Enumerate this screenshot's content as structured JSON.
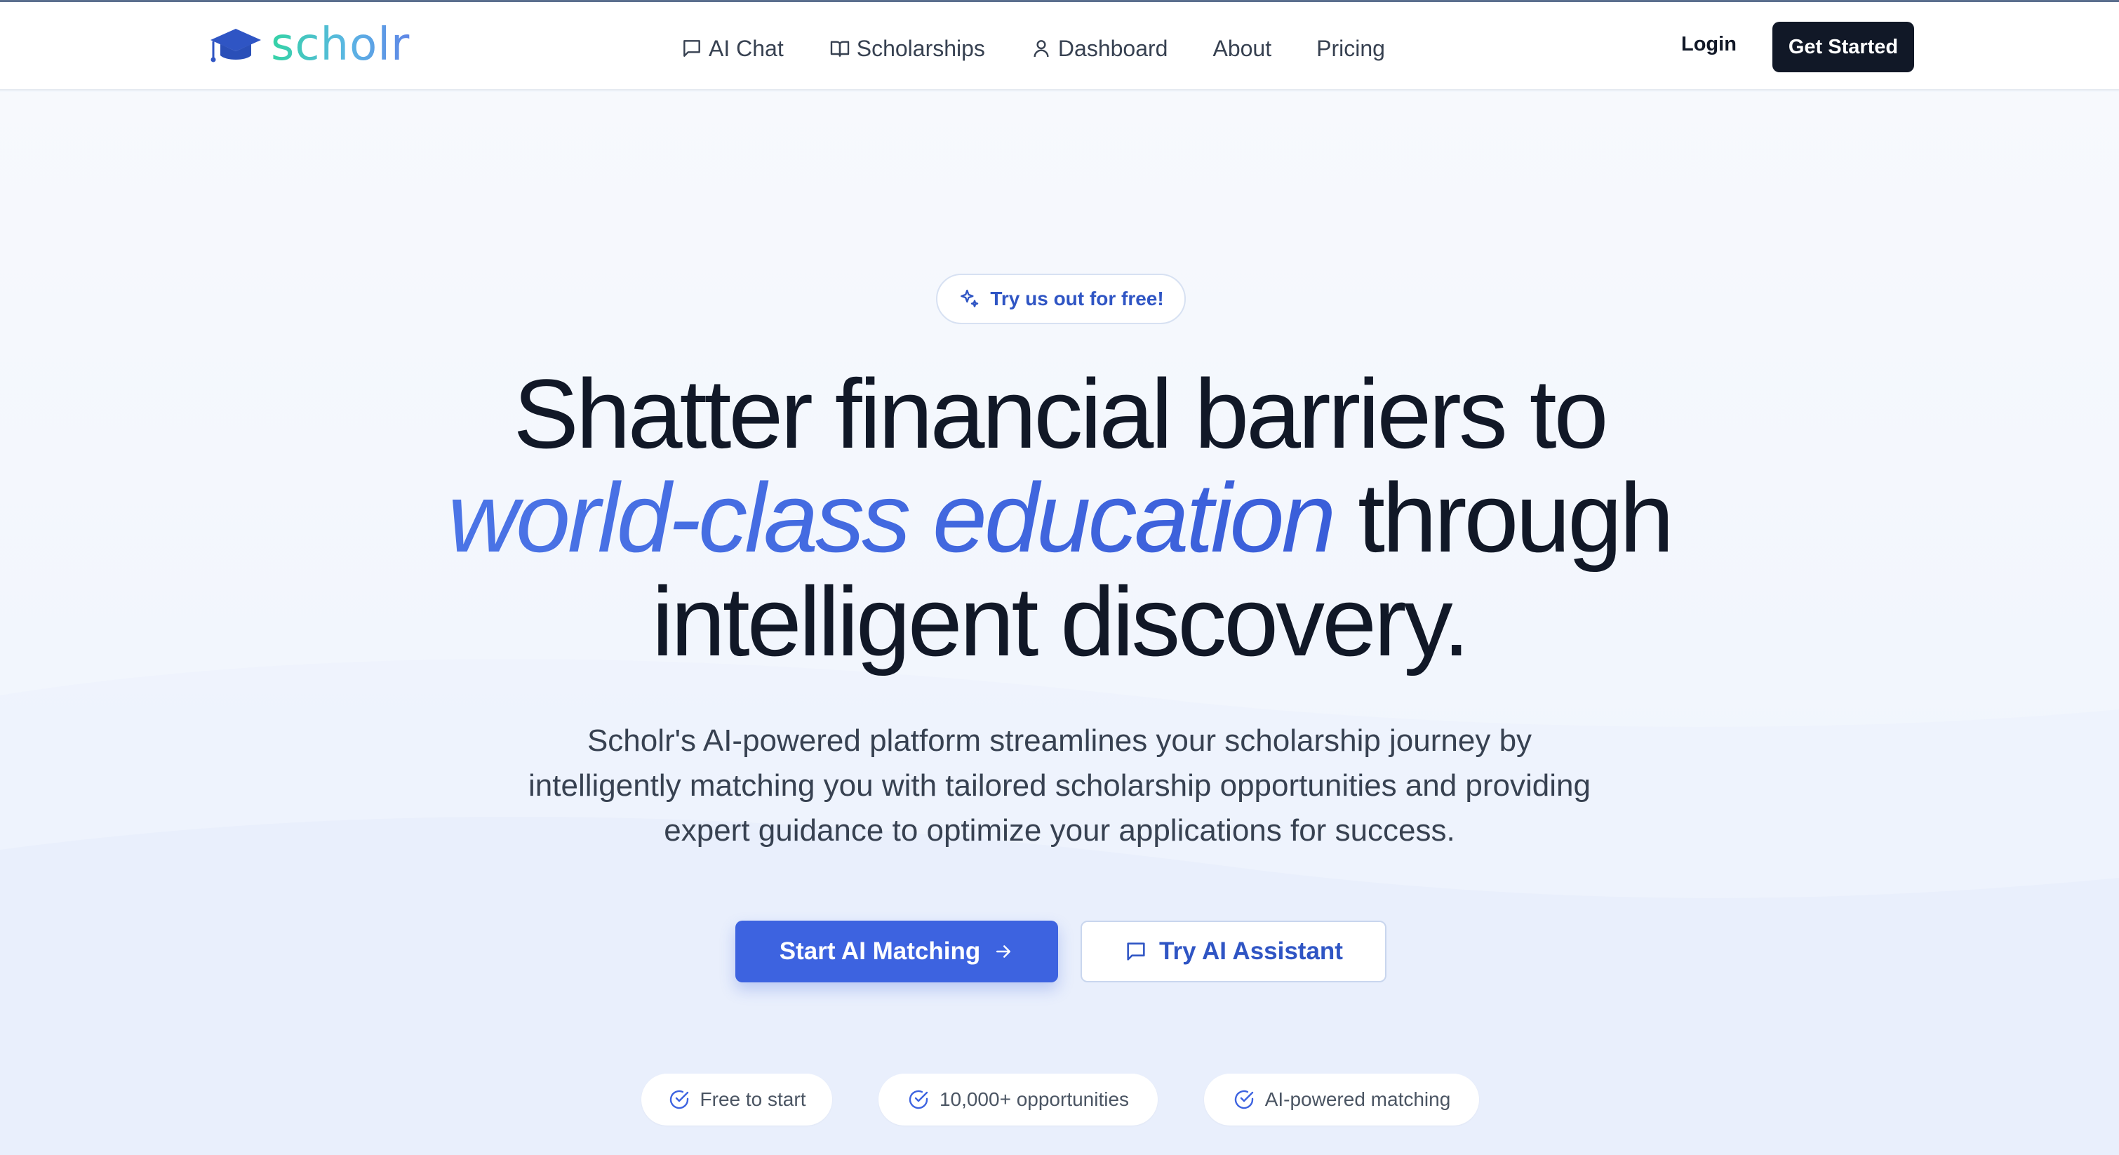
{
  "brand": {
    "name": "scholr",
    "logo_icon": "graduation-cap-icon"
  },
  "nav": {
    "items": [
      {
        "label": "AI Chat",
        "icon": "chat-bubble-icon"
      },
      {
        "label": "Scholarships",
        "icon": "book-open-icon"
      },
      {
        "label": "Dashboard",
        "icon": "user-icon"
      },
      {
        "label": "About",
        "icon": ""
      },
      {
        "label": "Pricing",
        "icon": ""
      }
    ],
    "login_label": "Login",
    "get_started_label": "Get Started"
  },
  "hero": {
    "badge": {
      "label": "Try us out for free!",
      "icon": "sparkles-icon"
    },
    "headline": {
      "line1": "Shatter financial barriers to",
      "accent": "world-class education",
      "line2_rest": " through",
      "line3": "intelligent discovery."
    },
    "subtitle": "Scholr's AI-powered platform streamlines your scholarship journey by intelligently matching you with tailored scholarship opportunities and providing expert guidance to optimize your applications for success.",
    "primary_cta": {
      "label": "Start AI Matching",
      "icon": "arrow-right-icon"
    },
    "secondary_cta": {
      "label": "Try AI Assistant",
      "icon": "chat-bubble-icon"
    },
    "features": [
      {
        "label": "Free to start",
        "icon": "check-circle-icon"
      },
      {
        "label": "10,000+ opportunities",
        "icon": "check-circle-icon"
      },
      {
        "label": "AI-powered matching",
        "icon": "check-circle-icon"
      }
    ]
  },
  "colors": {
    "primary": "#3d63e0",
    "accent_text": "#2f55c4",
    "dark": "#111827",
    "logo_gradient_start": "#34d3a5",
    "logo_gradient_end": "#5f86e6",
    "background": "#f3f7fd"
  }
}
